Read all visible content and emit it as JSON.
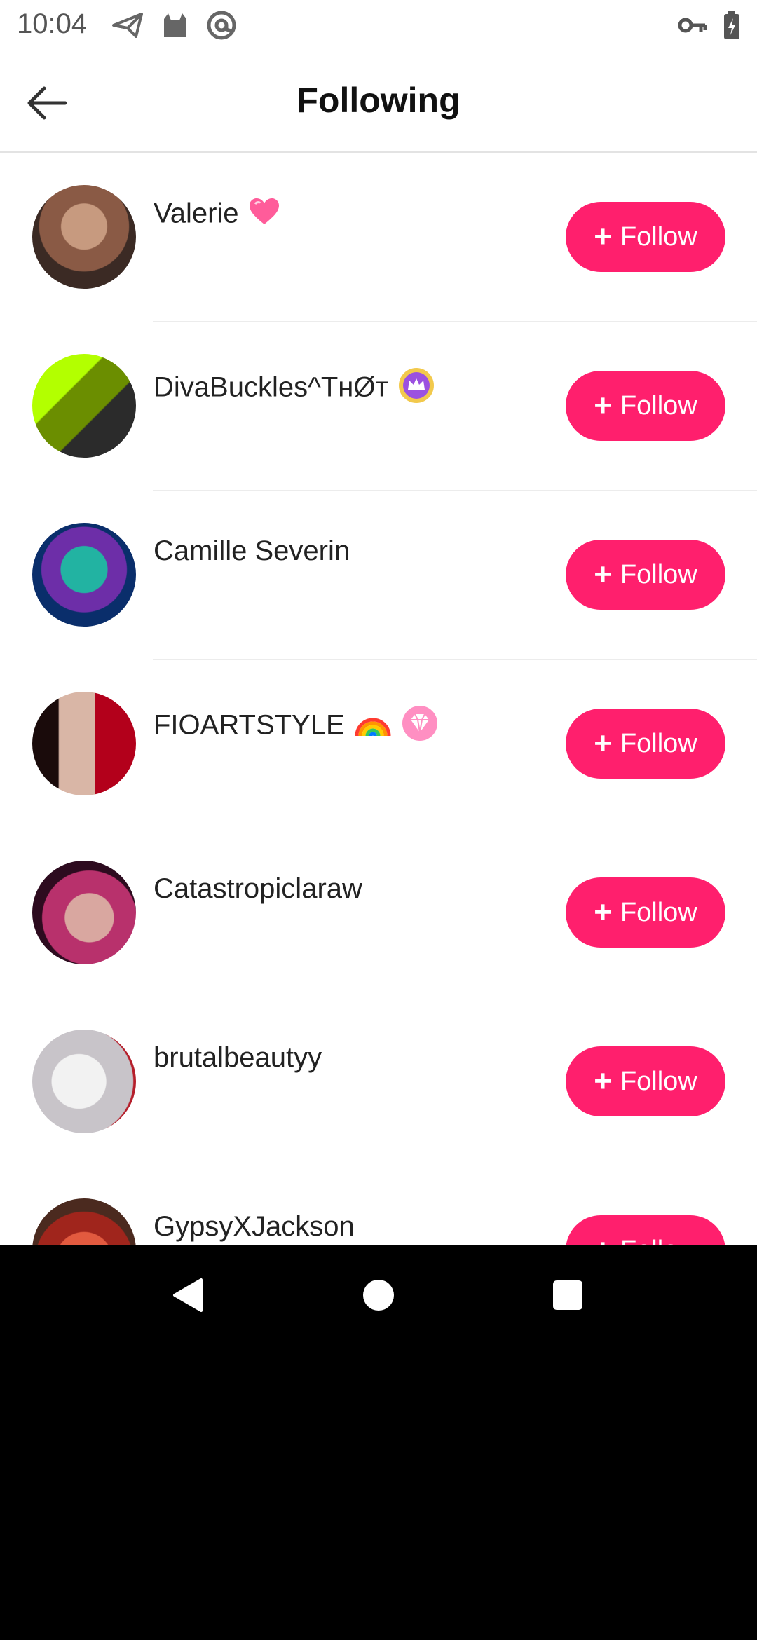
{
  "status_bar": {
    "time": "10:04",
    "icons": [
      "send-icon",
      "cat-icon",
      "at-sign-icon",
      "key-icon",
      "battery-charging-icon"
    ]
  },
  "app_bar": {
    "title": "Following",
    "back_icon": "arrow-left-icon"
  },
  "following": [
    {
      "name": "Valerie",
      "emoji": "pink-heart-icon",
      "button_label": "Follow",
      "avatar_colors": [
        "#3b2a24",
        "#8a5a45",
        "#c79a7f"
      ]
    },
    {
      "name": "DivaBuckles^TнØт",
      "emoji": "crown-badge-icon",
      "button_label": "Follow",
      "avatar_colors": [
        "#6b8e00",
        "#b3ff00",
        "#2b2b2b"
      ]
    },
    {
      "name": "Camille Severin",
      "emoji": "",
      "button_label": "Follow",
      "avatar_colors": [
        "#0a2e6b",
        "#22b3a2",
        "#6d2ea8"
      ]
    },
    {
      "name": "FIOARTSTYLE",
      "emoji": "rainbow-and-gem-icons",
      "button_label": "Follow",
      "avatar_colors": [
        "#1a0b0b",
        "#b3001b",
        "#d9b6a6"
      ]
    },
    {
      "name": "Catastropiclaraw",
      "emoji": "",
      "button_label": "Follow",
      "avatar_colors": [
        "#2d0b1f",
        "#b8316c",
        "#d9a7a0"
      ]
    },
    {
      "name": "brutalbeautyy",
      "emoji": "",
      "button_label": "Follow",
      "avatar_colors": [
        "#f2f2f2",
        "#c8c4c9",
        "#b51e2a"
      ]
    },
    {
      "name": "GypsyXJackson",
      "emoji": "",
      "button_label": "Follow",
      "avatar_colors": [
        "#a0251c",
        "#e25a3f",
        "#4b2a1f"
      ]
    }
  ],
  "colors": {
    "accent": "#ff1f6d",
    "background": "#ffffff",
    "text": "#222222"
  },
  "nav_bar": {
    "icons": [
      "back-triangle-icon",
      "home-circle-icon",
      "recents-square-icon"
    ]
  }
}
